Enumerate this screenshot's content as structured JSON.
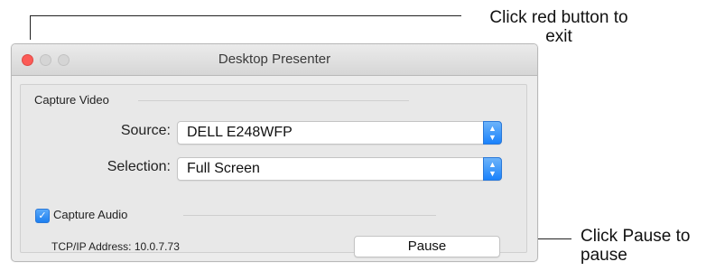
{
  "window": {
    "title": "Desktop Presenter"
  },
  "capture_video": {
    "section_label": "Capture Video",
    "source_label": "Source:",
    "source_value": "DELL E248WFP",
    "selection_label": "Selection:",
    "selection_value": "Full Screen"
  },
  "capture_audio": {
    "label": "Capture Audio",
    "checked": true
  },
  "network": {
    "address_text": "TCP/IP Address: 10.0.7.73"
  },
  "buttons": {
    "pause_label": "Pause"
  },
  "annotations": {
    "top_line1": "Click red button to",
    "top_line2": "exit",
    "bottom_line1": "Click Pause to",
    "bottom_line2": "pause"
  },
  "icons": {
    "checkbox": "checkmark-icon",
    "stepper": "up-down-chevron-icon"
  },
  "colors": {
    "close_button": "#fc5b57",
    "accent_blue": "#1a82fb"
  }
}
